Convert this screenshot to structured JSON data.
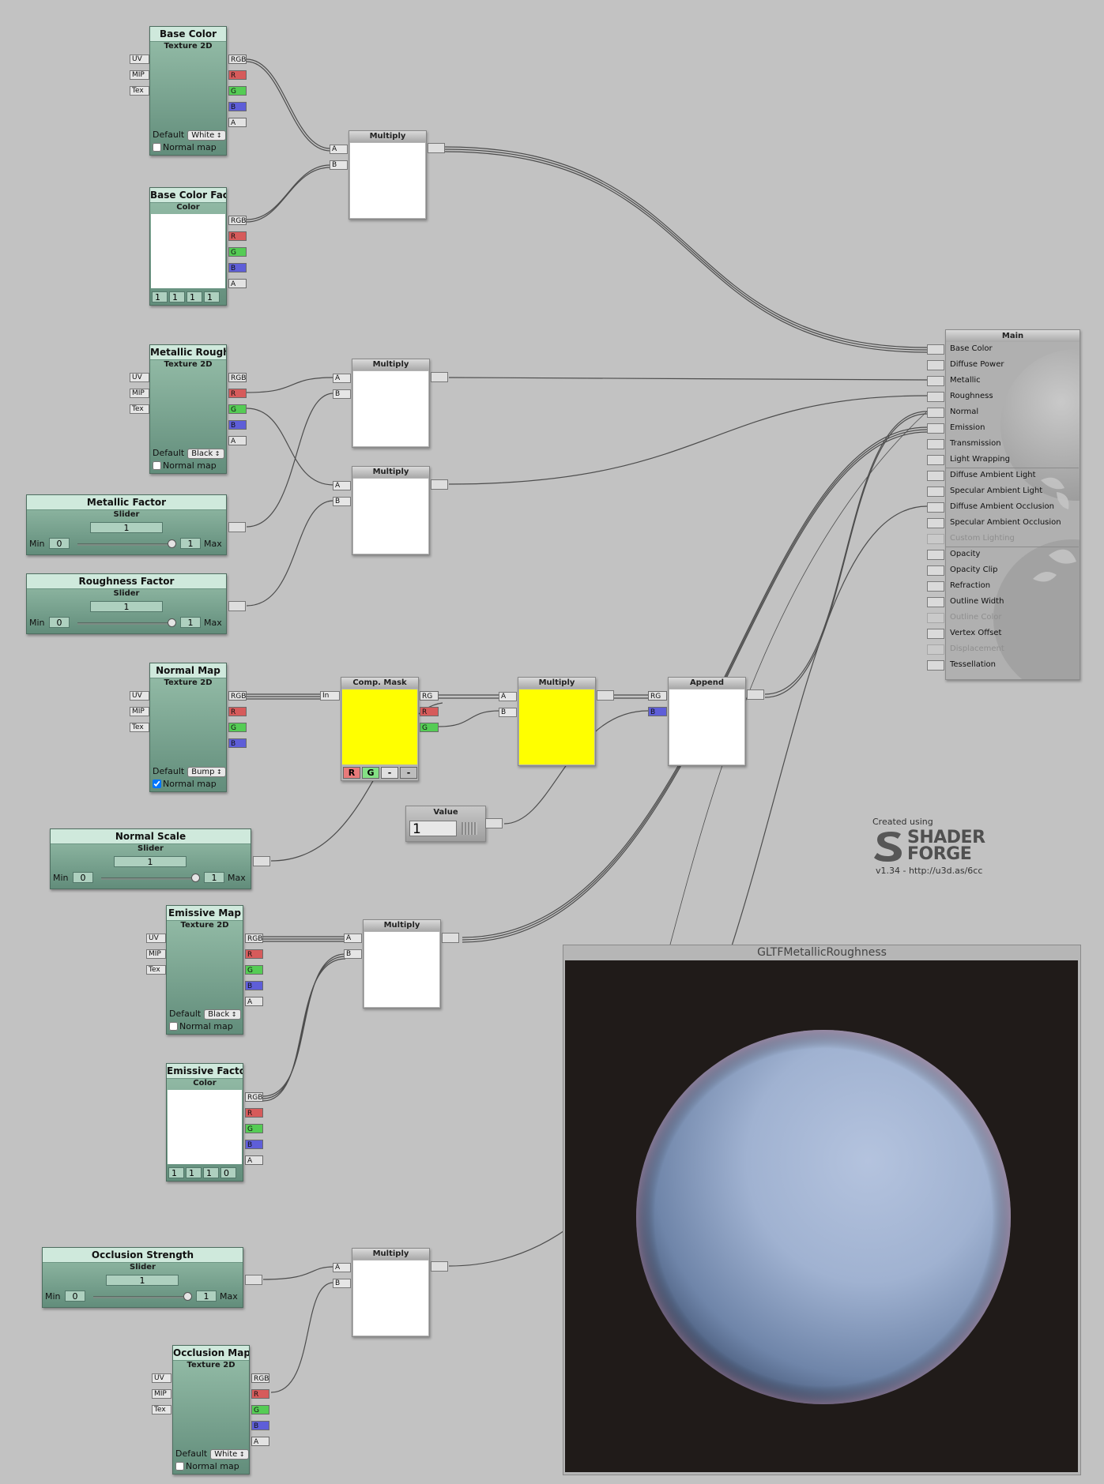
{
  "nodes": {
    "base_color_tex": {
      "title": "Base Color",
      "subtitle": "Texture 2D",
      "inputs": [
        "UV",
        "MIP",
        "Tex"
      ],
      "outputs": [
        "RGB",
        "R",
        "G",
        "B",
        "A"
      ],
      "default_label": "Default",
      "default_value": "White",
      "normal_map_label": "Normal map",
      "normal_map_checked": false
    },
    "base_color_factor": {
      "title": "Base Color Factor",
      "subtitle": "Color",
      "outputs": [
        "RGB",
        "R",
        "G",
        "B",
        "A"
      ],
      "values": [
        "1",
        "1",
        "1",
        "1"
      ]
    },
    "metallic_roughness_tex": {
      "title": "Metallic Roughness",
      "subtitle": "Texture 2D",
      "inputs": [
        "UV",
        "MIP",
        "Tex"
      ],
      "outputs": [
        "RGB",
        "R",
        "G",
        "B",
        "A"
      ],
      "default_label": "Default",
      "default_value": "Black",
      "normal_map_label": "Normal map",
      "normal_map_checked": false
    },
    "metallic_factor": {
      "title": "Metallic Factor",
      "subtitle": "Slider",
      "value": "1",
      "min_label": "Min",
      "min": "0",
      "max": "1",
      "max_label": "Max",
      "level": 1.0
    },
    "roughness_factor": {
      "title": "Roughness Factor",
      "subtitle": "Slider",
      "value": "1",
      "min_label": "Min",
      "min": "0",
      "max": "1",
      "max_label": "Max",
      "level": 1.0
    },
    "normal_map_tex": {
      "title": "Normal Map",
      "subtitle": "Texture 2D",
      "inputs": [
        "UV",
        "MIP",
        "Tex"
      ],
      "outputs": [
        "RGB",
        "R",
        "G",
        "B"
      ],
      "default_label": "Default",
      "default_value": "Bump",
      "normal_map_label": "Normal map",
      "normal_map_checked": true
    },
    "normal_scale": {
      "title": "Normal Scale",
      "subtitle": "Slider",
      "value": "1",
      "min_label": "Min",
      "min": "0",
      "max": "1",
      "max_label": "Max",
      "level": 1.0
    },
    "emissive_map_tex": {
      "title": "Emissive Map",
      "subtitle": "Texture 2D",
      "inputs": [
        "UV",
        "MIP",
        "Tex"
      ],
      "outputs": [
        "RGB",
        "R",
        "G",
        "B",
        "A"
      ],
      "default_label": "Default",
      "default_value": "Black",
      "normal_map_label": "Normal map",
      "normal_map_checked": false
    },
    "emissive_factor": {
      "title": "Emissive Factor",
      "subtitle": "Color",
      "outputs": [
        "RGB",
        "R",
        "G",
        "B",
        "A"
      ],
      "values": [
        "1",
        "1",
        "1",
        "0"
      ]
    },
    "occlusion_strength": {
      "title": "Occlusion Strength",
      "subtitle": "Slider",
      "value": "1",
      "min_label": "Min",
      "min": "0",
      "max": "1",
      "max_label": "Max",
      "level": 1.0
    },
    "occlusion_map_tex": {
      "title": "Occlusion Map",
      "subtitle": "Texture 2D",
      "inputs": [
        "UV",
        "MIP",
        "Tex"
      ],
      "outputs": [
        "RGB",
        "R",
        "G",
        "B",
        "A"
      ],
      "default_label": "Default",
      "default_value": "White",
      "normal_map_label": "Normal map",
      "normal_map_checked": false
    },
    "multiply_1": {
      "title": "Multiply",
      "inputs": [
        "A",
        "B"
      ]
    },
    "multiply_2": {
      "title": "Multiply",
      "inputs": [
        "A",
        "B"
      ]
    },
    "multiply_3": {
      "title": "Multiply",
      "inputs": [
        "A",
        "B"
      ]
    },
    "multiply_4": {
      "title": "Multiply",
      "inputs": [
        "A",
        "B"
      ]
    },
    "multiply_5": {
      "title": "Multiply",
      "inputs": [
        "A",
        "B"
      ]
    },
    "multiply_6": {
      "title": "Multiply",
      "inputs": [
        "A",
        "B"
      ]
    },
    "comp_mask": {
      "title": "Comp. Mask",
      "input": "In",
      "outputs": [
        "RG",
        "R",
        "G"
      ],
      "channels": [
        "R",
        "G",
        "-",
        "-"
      ]
    },
    "append": {
      "title": "Append",
      "outputs": [
        "RG",
        "B"
      ]
    },
    "value_node": {
      "title": "Value",
      "value": "1"
    }
  },
  "main": {
    "title": "Main",
    "inputs": [
      {
        "label": "Base Color",
        "enabled": true
      },
      {
        "label": "Diffuse Power",
        "enabled": true
      },
      {
        "label": "Metallic",
        "enabled": true
      },
      {
        "label": "Roughness",
        "enabled": true
      },
      {
        "label": "Normal",
        "enabled": true
      },
      {
        "label": "Emission",
        "enabled": true
      },
      {
        "label": "Transmission",
        "enabled": true
      },
      {
        "label": "Light Wrapping",
        "enabled": true
      },
      {
        "label": "Diffuse Ambient Light",
        "enabled": true
      },
      {
        "label": "Specular Ambient Light",
        "enabled": true
      },
      {
        "label": "Diffuse Ambient Occlusion",
        "enabled": true
      },
      {
        "label": "Specular Ambient Occlusion",
        "enabled": true
      },
      {
        "label": "Custom Lighting",
        "enabled": false
      },
      {
        "label": "Opacity",
        "enabled": true
      },
      {
        "label": "Opacity Clip",
        "enabled": true
      },
      {
        "label": "Refraction",
        "enabled": true
      },
      {
        "label": "Outline Width",
        "enabled": true
      },
      {
        "label": "Outline Color",
        "enabled": false
      },
      {
        "label": "Vertex Offset",
        "enabled": true
      },
      {
        "label": "Displacement",
        "enabled": false
      },
      {
        "label": "Tessellation",
        "enabled": true
      }
    ]
  },
  "credits": {
    "created_using": "Created using",
    "brand_line1": "SHADER",
    "brand_line2": "FORGE",
    "version": "v1.34 - http://u3d.as/6cc"
  },
  "preview": {
    "title": "GLTFMetallicRoughness"
  },
  "colors": {
    "node_green": "#7fa895",
    "title_green": "#cfe9dc",
    "canvas": "#c2c2c2",
    "yellow_preview": "#ffff00",
    "port_r": "#d65b5b",
    "port_g": "#55cc55",
    "port_b": "#5e5ed8",
    "sphere": "#9fb1d0",
    "preview_bg": "#201b19"
  },
  "icons": {
    "shader_forge_logo": "shader-forge-logo-icon",
    "value_grid": "grid-icon",
    "dropdown": "updown-arrows-icon"
  }
}
